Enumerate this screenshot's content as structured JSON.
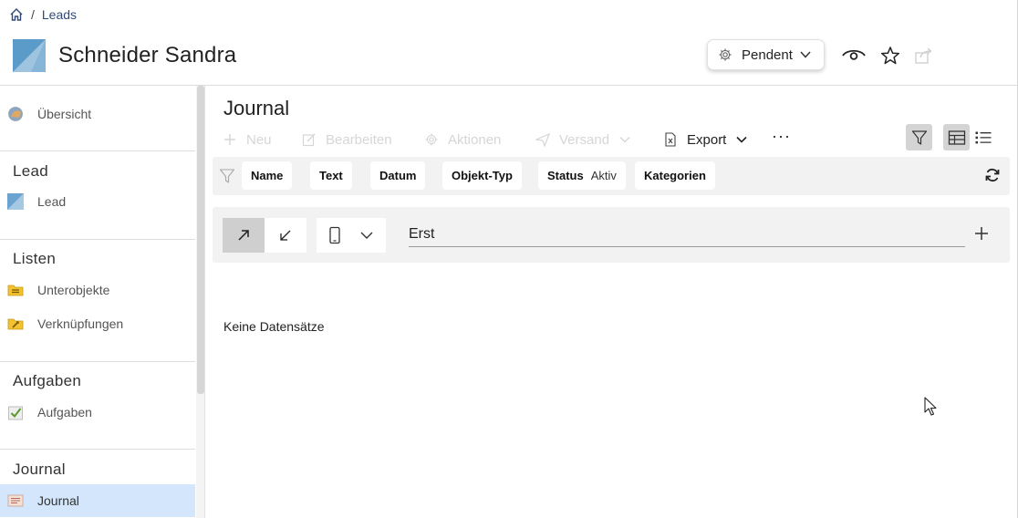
{
  "breadcrumb": {
    "separator": "/",
    "current": "Leads"
  },
  "record": {
    "title": "Schneider Sandra"
  },
  "header": {
    "status_label": "Pendent",
    "icons": [
      "gear-icon",
      "chevron-down-icon",
      "eye-icon",
      "star-icon",
      "share-icon"
    ]
  },
  "sidebar": {
    "overview": {
      "label": "Übersicht"
    },
    "sections": [
      {
        "title": "Lead",
        "items": [
          {
            "label": "Lead",
            "icon": "lead-icon"
          }
        ]
      },
      {
        "title": "Listen",
        "items": [
          {
            "label": "Unterobjekte",
            "icon": "folder-list-icon"
          },
          {
            "label": "Verknüpfungen",
            "icon": "folder-link-icon"
          }
        ]
      },
      {
        "title": "Aufgaben",
        "items": [
          {
            "label": "Aufgaben",
            "icon": "task-check-icon"
          }
        ]
      },
      {
        "title": "Journal",
        "items": [
          {
            "label": "Journal",
            "icon": "journal-icon",
            "active": true
          }
        ]
      }
    ]
  },
  "main": {
    "title": "Journal",
    "toolbar": {
      "new": "Neu",
      "edit": "Bearbeiten",
      "actions": "Aktionen",
      "send": "Versand",
      "export": "Export",
      "more": "···"
    },
    "filters": [
      {
        "label": "Name"
      },
      {
        "label": "Text"
      },
      {
        "label": "Datum"
      },
      {
        "label": "Objekt-Typ"
      },
      {
        "label": "Status",
        "value": "Aktiv"
      },
      {
        "label": "Kategorien"
      }
    ],
    "entry": {
      "value": "Erst"
    },
    "empty_text": "Keine Datensätze"
  },
  "colors": {
    "active_item": "#d3e6fb",
    "accent_link": "#2f4a7a",
    "bar_bg": "#f2f2f2"
  }
}
